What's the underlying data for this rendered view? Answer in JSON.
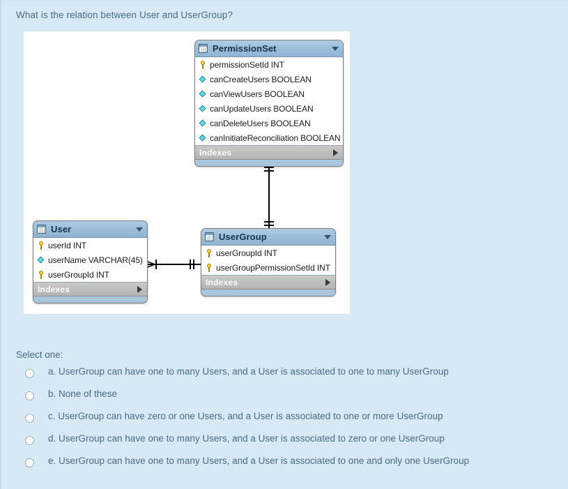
{
  "question": {
    "text": "What is the relation between User and UserGroup?"
  },
  "diagram": {
    "tables": [
      {
        "name": "PermissionSet",
        "icon": "table-icon",
        "caret_icon": "chevron-down-icon",
        "indexes_label": "Indexes",
        "indexes_caret_icon": "chevron-right-icon",
        "columns": [
          {
            "icon": "key-icon",
            "text": "permissionSetId INT"
          },
          {
            "icon": "diamond-icon",
            "text": "canCreateUsers BOOLEAN"
          },
          {
            "icon": "diamond-icon",
            "text": "canViewUsers BOOLEAN"
          },
          {
            "icon": "diamond-icon",
            "text": "canUpdateUsers BOOLEAN"
          },
          {
            "icon": "diamond-icon",
            "text": "canDeleteUsers BOOLEAN"
          },
          {
            "icon": "diamond-icon",
            "text": "canInitiateReconciliation BOOLEAN"
          }
        ]
      },
      {
        "name": "User",
        "icon": "table-icon",
        "caret_icon": "chevron-down-icon",
        "indexes_label": "Indexes",
        "indexes_caret_icon": "chevron-right-icon",
        "columns": [
          {
            "icon": "key-icon",
            "text": "userId INT"
          },
          {
            "icon": "diamond-icon",
            "text": "userName VARCHAR(45)"
          },
          {
            "icon": "key-icon",
            "text": "userGroupId INT"
          }
        ]
      },
      {
        "name": "UserGroup",
        "icon": "table-icon",
        "caret_icon": "chevron-down-icon",
        "indexes_label": "Indexes",
        "indexes_caret_icon": "chevron-right-icon",
        "columns": [
          {
            "icon": "key-icon",
            "text": "userGroupId INT"
          },
          {
            "icon": "key-icon",
            "text": "userGroupPermissionSetId INT"
          }
        ]
      }
    ],
    "relationships": [
      {
        "from": "PermissionSet",
        "to": "UserGroup",
        "from_notation": "one-and-only-one",
        "to_notation": "one-and-only-one",
        "orientation": "vertical"
      },
      {
        "from": "User",
        "to": "UserGroup",
        "from_notation": "one-to-many-crowsfoot",
        "to_notation": "one-and-only-one",
        "orientation": "horizontal"
      }
    ]
  },
  "answers": {
    "prompt": "Select one:",
    "options": [
      {
        "label": "a. UserGroup can have one to many Users, and a User is associated to one to many UserGroup"
      },
      {
        "label": "b. None of these"
      },
      {
        "label": "c. UserGroup can have zero or one Users, and a User is associated to one or more UserGroup"
      },
      {
        "label": "d. UserGroup can have one to many Users, and a User is associated to zero or one UserGroup"
      },
      {
        "label": "e. UserGroup can have one to many Users, and a User is associated to one and only one UserGroup"
      }
    ]
  },
  "colors": {
    "page_background": "#d7e9f4",
    "canvas_background": "#ffffff",
    "table_header": "#9dbed9",
    "table_body": "#ffffff",
    "indexes_bar": "#b4b4b4",
    "text": "#4a6b85",
    "key_icon": "#f4d03f",
    "diamond_icon": "#5fe0e8"
  }
}
